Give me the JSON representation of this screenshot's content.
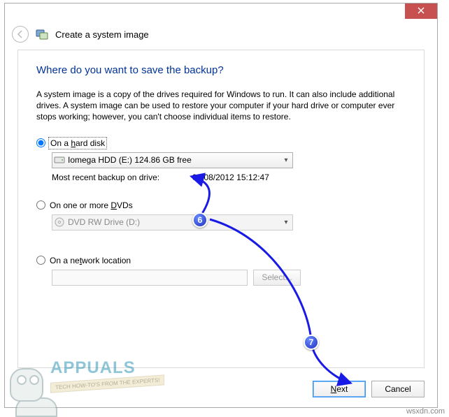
{
  "window": {
    "title": "Create a system image"
  },
  "page": {
    "heading": "Where do you want to save the backup?",
    "description": "A system image is a copy of the drives required for Windows to run. It can also include additional drives. A system image can be used to restore your computer if your hard drive or computer ever stops working; however, you can't choose individual items to restore."
  },
  "options": {
    "hard_disk": {
      "label_pre": "On a ",
      "label_key": "h",
      "label_post": "ard disk",
      "selected": true,
      "dropdown_value": "Iomega HDD (E:)  124.86 GB free",
      "recent_label": "Most recent backup on drive:",
      "recent_value": "04/08/2012 15:12:47"
    },
    "dvd": {
      "label_pre": "On one or more ",
      "label_key": "D",
      "label_post": "VDs",
      "dropdown_value": "DVD RW Drive (D:)"
    },
    "network": {
      "label_pre": "On a ne",
      "label_key": "t",
      "label_post": "work location",
      "select_button": "Select..."
    }
  },
  "footer": {
    "next": "Next",
    "next_key": "N",
    "next_rest": "ext",
    "cancel": "Cancel"
  },
  "annotations": {
    "badge6": "6",
    "badge7": "7"
  },
  "watermark": {
    "brand": "APPUALS",
    "tagline": "TECH HOW-TO'S FROM THE EXPERTS!",
    "site": "wsxdn.com"
  }
}
